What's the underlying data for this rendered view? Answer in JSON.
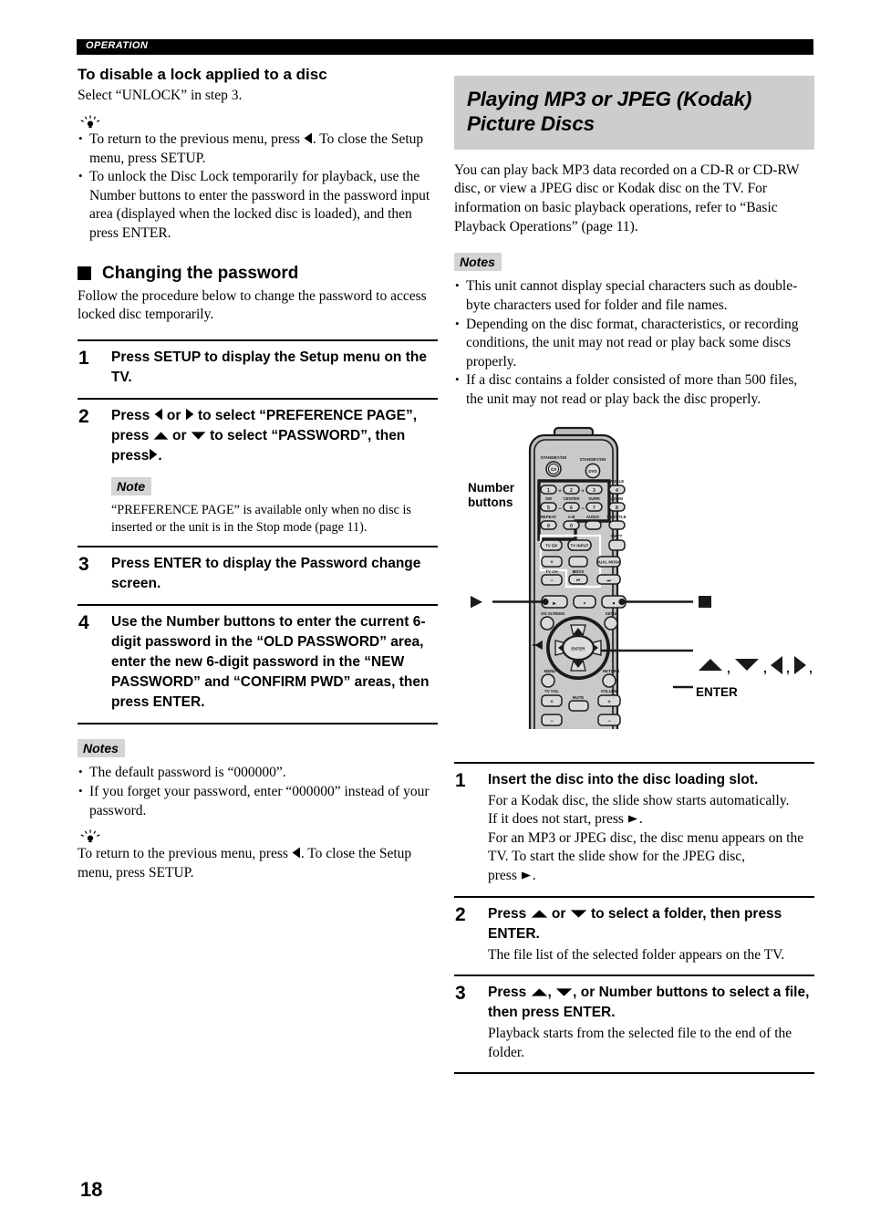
{
  "header": {
    "band_label": "OPERATION"
  },
  "page_number": "18",
  "left_column": {
    "section1": {
      "heading": "To disable a lock applied to a disc",
      "body": "Select “UNLOCK” in step 3.",
      "tip_icon": "lightbulb-tip-icon",
      "tips": [
        "To return to the previous menu, press ◀. To close the Setup menu, press SETUP.",
        "To unlock the Disc Lock temporarily for playback, use the Number buttons to enter the password in the password input area (displayed when the locked disc is loaded), and then press ENTER."
      ],
      "tip1_part1": "To return to the previous menu, press",
      "tip1_part2": ". To close the Setup menu, press SETUP.",
      "tip2": "To unlock the Disc Lock temporarily for playback, use the Number buttons to enter the password in the password input area (displayed when the locked disc is loaded), and then press ENTER."
    },
    "section2": {
      "square_heading": "Changing the password",
      "intro": "Follow the procedure below to change the password to access locked disc temporarily.",
      "steps": [
        {
          "num": "1",
          "title": "Press SETUP to display the Setup menu on the TV."
        },
        {
          "num": "2",
          "title_p1": "Press",
          "title_p2": "or",
          "title_p3": "to select “PREFERENCE PAGE”, press",
          "title_p4": "or",
          "title_p5": "to select “PASSWORD”, then press",
          "title_p6": ".",
          "note_tag": "Note",
          "note_body": "“PREFERENCE PAGE” is available only when no disc is inserted or the unit is in the Stop mode (page 11)."
        },
        {
          "num": "3",
          "title": "Press ENTER to display the Password change screen."
        },
        {
          "num": "4",
          "title": "Use the Number buttons to enter the current 6-digit password in the “OLD PASSWORD” area, enter the new 6-digit password in the “NEW PASSWORD” and “CONFIRM PWD” areas, then press ENTER."
        }
      ],
      "notes_tag": "Notes",
      "notes": [
        "The default password is “000000”.",
        "If you forget your password, enter “000000” instead of your password."
      ],
      "tip_icon": "lightbulb-tip-icon",
      "tip_p1": "To return to the previous menu, press",
      "tip_p2": ". To close the Setup menu, press SETUP."
    }
  },
  "right_column": {
    "title": "Playing MP3 or JPEG (Kodak) Picture Discs",
    "intro": "You can play back MP3 data recorded on a CD-R or CD-RW disc, or view a JPEG disc or Kodak disc on the TV. For information on basic playback operations, refer to “Basic Playback Operations” (page 11).",
    "notes_tag": "Notes",
    "notes": [
      "This unit cannot display special characters such as double-byte characters used for folder and file names.",
      "Depending on the disc format, characteristics, or recording conditions, the unit may not read or play back some discs properly.",
      "If a disc contains a folder consisted of more than 500 files, the unit may not read or play back the disc properly."
    ],
    "figure": {
      "callout_number_buttons": "Number\nbuttons",
      "callout_number_buttons_line1": "Number",
      "callout_number_buttons_line2": "buttons",
      "callout_enter": "ENTER",
      "remote": {
        "standby_on_left": "STANDBY/ON",
        "standby_on_right": "STANDBY/ON",
        "power_left_glyph": "⏻/I",
        "power_right_glyph": "DVD",
        "number_keys": [
          "1",
          "2",
          "3",
          "4",
          "5",
          "6",
          "7",
          "8",
          "9",
          "0"
        ],
        "key_top_labels": {
          "4": "ANGLE",
          "5": "SW",
          "6": "CENTER",
          "7": "SURR",
          "8": "ZOOM",
          "9": "REPEAT",
          "0": "A-B"
        },
        "audio_label": "AUDIO",
        "subtitle_label": "SUBTITLE",
        "shift_label": "SHIFT",
        "tv_power_label": "TV ⏻/I",
        "tv_input_label": "TV INPUT",
        "tv_ch_label": "TV CH",
        "dvs_label": "DVS",
        "dual_mono_label": "DUAL MONO",
        "on_screen_label": "ON SCREEN",
        "setup_label": "SETUP",
        "menu_label": "MENU",
        "return_label": "RETURN",
        "enter_label": "ENTER",
        "tv_vol_label": "TV VOL",
        "mute_label": "MUTE",
        "volume_label": "VOLUME",
        "plus_glyph": "+",
        "minus_glyph": "−"
      }
    },
    "steps": [
      {
        "num": "1",
        "title": "Insert the disc into the disc loading slot.",
        "desc_line1": "For a Kodak disc, the slide show starts automatically.",
        "desc_line2_p1": "If it does not start, press",
        "desc_line2_p2": ".",
        "desc_line3": "For an MP3 or JPEG disc, the disc menu appears on the TV. To start the slide show for the JPEG disc,",
        "desc_line4_p1": "press",
        "desc_line4_p2": "."
      },
      {
        "num": "2",
        "title_p1": "Press",
        "title_p2": "or",
        "title_p3": "to select a folder, then press ENTER.",
        "desc": "The file list of the selected folder appears on the TV."
      },
      {
        "num": "3",
        "title_p1": "Press",
        "title_p2": ",",
        "title_p3": ", or Number buttons to select a file, then press ENTER.",
        "desc": "Playback starts from the selected file to the end of the folder."
      }
    ]
  },
  "colors": {
    "header_band": "#000000",
    "title_band": "#cdcdcd",
    "note_tag_bg": "#d4d4d4",
    "remote_body": "#b9b9b9",
    "remote_key": "#d8d8d8"
  }
}
